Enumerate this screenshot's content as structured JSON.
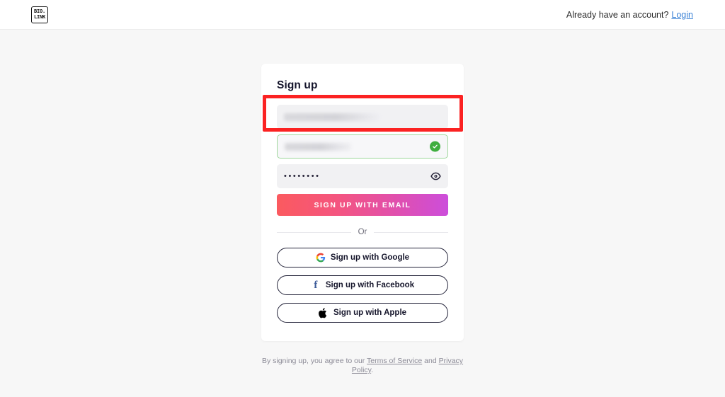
{
  "header": {
    "logo": {
      "name": "bio-link-logo",
      "line1": "BIO.",
      "line2": "LINK"
    },
    "account_prompt": "Already have an account?",
    "login_label": "Login"
  },
  "card": {
    "title": "Sign up",
    "fields": [
      {
        "name": "username-or-name-field",
        "value": "",
        "redacted": true,
        "state": "highlighted",
        "icon": null
      },
      {
        "name": "email-field",
        "value": "",
        "redacted": true,
        "state": "valid",
        "icon": "check-circle-icon"
      },
      {
        "name": "password-field",
        "value": "••••••••",
        "redacted": false,
        "state": "default",
        "icon": "eye-icon"
      }
    ],
    "submit_label": "Sign up with email",
    "divider_label": "Or",
    "social_buttons": [
      {
        "name": "google-signup-button",
        "label": "Sign up with Google",
        "icon": "google-icon"
      },
      {
        "name": "facebook-signup-button",
        "label": "Sign up with Facebook",
        "icon": "facebook-icon"
      },
      {
        "name": "apple-signup-button",
        "label": "Sign up with Apple",
        "icon": "apple-icon"
      }
    ]
  },
  "legal": {
    "prefix": "By signing up, you agree to our",
    "terms_label": "Terms of Service",
    "conjunction": "and",
    "privacy_label": "Privacy Policy",
    "suffix": "."
  },
  "colors": {
    "page_background": "#f7f7f7",
    "cta_gradient_start": "#fb5a5f",
    "cta_gradient_end": "#cc4edb",
    "link_blue": "#3b82d6",
    "valid_green": "#3fae3f",
    "annotation_red": "#fb2222",
    "facebook_blue": "#3b5998"
  },
  "annotation": {
    "name": "highlight-rectangle",
    "target": "username-or-name-field",
    "color": "#fb2222"
  }
}
